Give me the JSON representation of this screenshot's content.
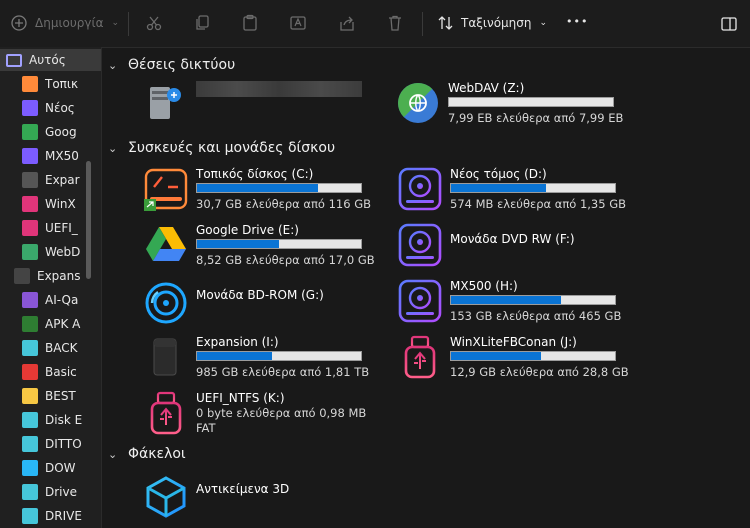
{
  "toolbar": {
    "new_label": "Δημιουργία",
    "sort_label": "Ταξινόμηση",
    "more_label": "•••"
  },
  "sidebar": {
    "items": [
      {
        "label": "Αυτός",
        "color": "#a2a2ff"
      },
      {
        "label": "Τοπικ",
        "color": "#ff8a3a"
      },
      {
        "label": "Νέος",
        "color": "#7c5cff"
      },
      {
        "label": "Goog",
        "color": "#34a853"
      },
      {
        "label": "MX50",
        "color": "#7c5cff"
      },
      {
        "label": "Expar",
        "color": "#555555"
      },
      {
        "label": "WinX",
        "color": "#e0357a"
      },
      {
        "label": "UEFI_",
        "color": "#e0357a"
      },
      {
        "label": "WebD",
        "color": "#3aa86b"
      },
      {
        "label": "Expans",
        "color": "#444444"
      },
      {
        "label": "AI-Qa",
        "color": "#8a56d6"
      },
      {
        "label": "APK A",
        "color": "#2e7d32"
      },
      {
        "label": "BACK",
        "color": "#46c6d9"
      },
      {
        "label": "Basic",
        "color": "#e53935"
      },
      {
        "label": "BEST",
        "color": "#f6c744"
      },
      {
        "label": "Disk E",
        "color": "#46c6d9"
      },
      {
        "label": "DITTO",
        "color": "#46c6d9"
      },
      {
        "label": "DOW",
        "color": "#29b6f6"
      },
      {
        "label": "Drive",
        "color": "#46c6d9"
      },
      {
        "label": "DRIVE",
        "color": "#46c6d9"
      }
    ]
  },
  "sections": {
    "network": "Θέσεις δικτύου",
    "drives": "Συσκευές και μονάδες δίσκου",
    "folders": "Φάκελοι"
  },
  "network": {
    "webdav_name": "WebDAV (Z:)",
    "webdav_free": "7,99 EB ελεύθερα από 7,99 EB",
    "webdav_fill": 0
  },
  "drives": [
    {
      "name": "Τοπικός δίσκος (C:)",
      "free": "30,7 GB ελεύθερα από 116 GB",
      "fill": 0.74
    },
    {
      "name": "Νέος τόμος (D:)",
      "free": "574 MB ελεύθερα από 1,35 GB",
      "fill": 0.58
    },
    {
      "name": "Google Drive (E:)",
      "free": "8,52 GB ελεύθερα από 17,0 GB",
      "fill": 0.5
    },
    {
      "name": "Μονάδα DVD RW (F:)"
    },
    {
      "name": "Μονάδα BD-ROM (G:)"
    },
    {
      "name": "MX500 (H:)",
      "free": "153 GB ελεύθερα από 465 GB",
      "fill": 0.67
    },
    {
      "name": "Expansion (I:)",
      "free": "985 GB ελεύθερα από 1,81 TB",
      "fill": 0.46
    },
    {
      "name": "WinXLiteFBConan (J:)",
      "free": "12,9 GB ελεύθερα από 28,8 GB",
      "fill": 0.55
    },
    {
      "name": "UEFI_NTFS (K:)",
      "free": "0 byte ελεύθερα από 0,98 MB",
      "fs": "FAT"
    }
  ],
  "folders": [
    {
      "name": "Αντικείμενα 3D"
    }
  ]
}
